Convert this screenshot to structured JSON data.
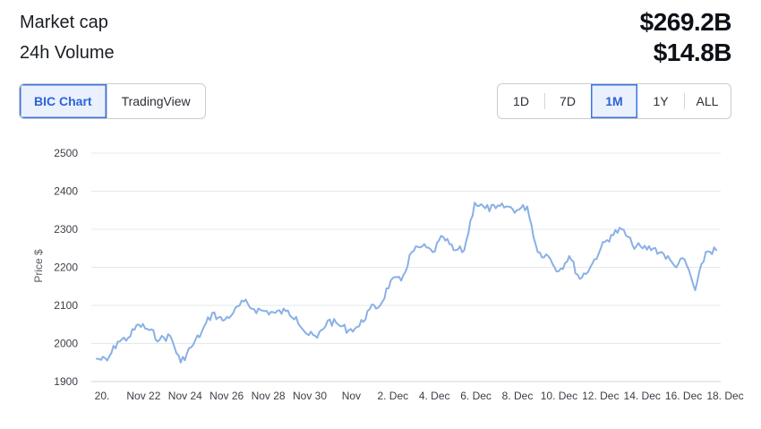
{
  "stats": {
    "market_cap_label": "Market cap",
    "market_cap_value": "$269.2B",
    "volume_label": "24h Volume",
    "volume_value": "$14.8B"
  },
  "chart_source_tabs": [
    {
      "label": "BIC Chart",
      "active": true
    },
    {
      "label": "TradingView",
      "active": false
    }
  ],
  "range_tabs": [
    {
      "label": "1D",
      "active": false
    },
    {
      "label": "7D",
      "active": false
    },
    {
      "label": "1M",
      "active": true
    },
    {
      "label": "1Y",
      "active": false
    },
    {
      "label": "ALL",
      "active": false
    }
  ],
  "colors": {
    "line": "#8ab0e6",
    "grid": "#e6e8eb",
    "accent": "#3b73e0"
  },
  "chart_data": {
    "type": "line",
    "ylabel": "Price $",
    "xlabel": "",
    "ylim": [
      1900,
      2500
    ],
    "yticks": [
      1900,
      2000,
      2100,
      2200,
      2300,
      2400,
      2500
    ],
    "xticks": [
      "20.",
      "Nov 22",
      "Nov 24",
      "Nov 26",
      "Nov 28",
      "Nov 30",
      "Nov",
      "2. Dec",
      "4. Dec",
      "6. Dec",
      "8. Dec",
      "10. Dec",
      "12. Dec",
      "14. Dec",
      "16. Dec",
      "18. Dec"
    ],
    "grid": true,
    "series": [
      {
        "x": [
          "2023-11-20 00:00",
          "2023-11-20 12:00",
          "2023-11-21 00:00",
          "2023-11-21 12:00",
          "2023-11-22 00:00",
          "2023-11-22 12:00",
          "2023-11-23 00:00",
          "2023-11-23 12:00",
          "2023-11-24 00:00",
          "2023-11-24 12:00",
          "2023-11-25 00:00",
          "2023-11-25 12:00",
          "2023-11-26 00:00",
          "2023-11-26 12:00",
          "2023-11-27 00:00",
          "2023-11-27 12:00",
          "2023-11-28 00:00",
          "2023-11-28 12:00",
          "2023-11-29 00:00",
          "2023-11-29 12:00",
          "2023-11-30 00:00",
          "2023-11-30 12:00",
          "2023-12-01 00:00",
          "2023-12-01 12:00",
          "2023-12-02 00:00",
          "2023-12-02 12:00",
          "2023-12-03 00:00",
          "2023-12-03 12:00",
          "2023-12-04 00:00",
          "2023-12-04 12:00",
          "2023-12-05 00:00",
          "2023-12-05 12:00",
          "2023-12-06 00:00",
          "2023-12-06 12:00",
          "2023-12-07 00:00",
          "2023-12-07 12:00",
          "2023-12-08 00:00",
          "2023-12-08 12:00",
          "2023-12-09 00:00",
          "2023-12-09 12:00",
          "2023-12-10 00:00",
          "2023-12-10 12:00",
          "2023-12-11 00:00",
          "2023-12-11 12:00",
          "2023-12-12 00:00",
          "2023-12-12 12:00",
          "2023-12-13 00:00",
          "2023-12-13 12:00",
          "2023-12-14 00:00",
          "2023-12-14 12:00",
          "2023-12-15 00:00",
          "2023-12-15 12:00",
          "2023-12-16 00:00",
          "2023-12-16 12:00",
          "2023-12-17 00:00",
          "2023-12-17 12:00",
          "2023-12-18 00:00",
          "2023-12-18 12:00",
          "2023-12-19 00:00",
          "2023-12-19 12:00"
        ],
        "values": [
          1960,
          1955,
          2005,
          2015,
          2050,
          2035,
          2010,
          2020,
          1950,
          1990,
          2030,
          2080,
          2060,
          2080,
          2110,
          2090,
          2085,
          2080,
          2085,
          2070,
          2025,
          2015,
          2060,
          2050,
          2035,
          2045,
          2090,
          2100,
          2165,
          2165,
          2240,
          2255,
          2240,
          2280,
          2245,
          2245,
          2370,
          2355,
          2355,
          2360,
          2350,
          2360,
          2240,
          2230,
          2190,
          2230,
          2170,
          2200,
          2250,
          2285,
          2300,
          2260,
          2250,
          2250,
          2235,
          2205,
          2220,
          2140,
          2240,
          2245
        ]
      }
    ]
  }
}
